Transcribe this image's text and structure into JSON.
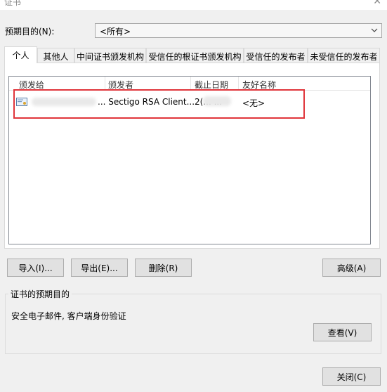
{
  "window": {
    "title": "证书",
    "close_glyph": "✕"
  },
  "purpose": {
    "label": "预期目的(N):",
    "selected": "<所有>"
  },
  "tabs": [
    {
      "label": "个人",
      "active": true
    },
    {
      "label": "其他人",
      "active": false
    },
    {
      "label": "中间证书颁发机构",
      "active": false
    },
    {
      "label": "受信任的根证书颁发机构",
      "active": false
    },
    {
      "label": "受信任的发布者",
      "active": false
    },
    {
      "label": "未受信任的发布者",
      "active": false
    }
  ],
  "list": {
    "columns": [
      "颁发给",
      "颁发者",
      "截止日期",
      "友好名称"
    ],
    "rows": [
      {
        "issued_to": "",
        "issuer": "... Sectigo RSA Client...",
        "expiry": "2(... ...",
        "friendly_name": "<无>"
      }
    ]
  },
  "buttons": {
    "import": "导入(I)...",
    "export": "导出(E)...",
    "remove": "删除(R)",
    "advanced": "高级(A)",
    "view": "查看(V)",
    "close": "关闭(C)"
  },
  "purposes_group": {
    "legend": "证书的预期目的",
    "text": "安全电子邮件, 客户端身份验证"
  },
  "icons": {
    "certificate": "certificate-icon",
    "dropdown": "chevron-down-icon",
    "close": "close-icon"
  },
  "colors": {
    "highlight": "#e0353b",
    "list_border": "#828790",
    "button_bg": "#e1e1e1"
  }
}
